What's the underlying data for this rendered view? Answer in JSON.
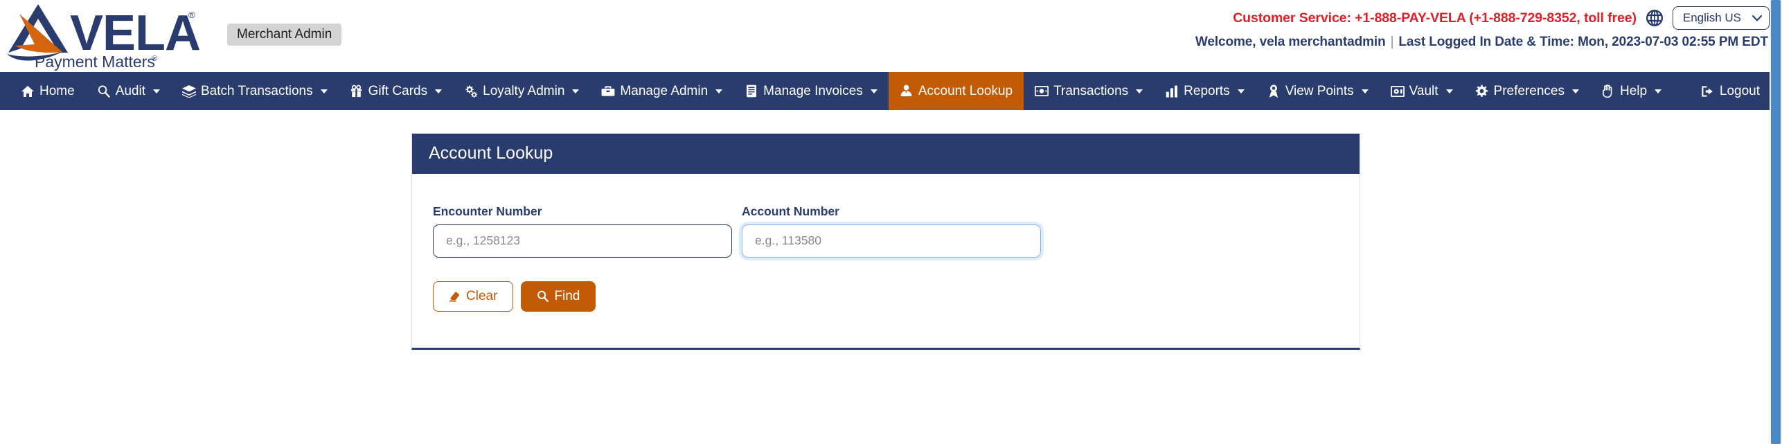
{
  "brand": {
    "name": "VELA",
    "tagline": "Payment Matters",
    "registered_mark": "®",
    "navy": "#2a3c6e",
    "orange": "#c25a06"
  },
  "header": {
    "role_badge": "Merchant Admin",
    "customer_service": "Customer Service: +1-888-PAY-VELA (+1-888-729-8352, toll free)",
    "globe_icon": "globe-icon",
    "language": {
      "selected": "English US",
      "caret_icon": "chevron-down-icon"
    },
    "welcome": "Welcome, vela merchantadmin",
    "separator": "|",
    "last_login": "Last Logged In Date & Time: Mon, 2023-07-03 02:55 PM EDT"
  },
  "nav": {
    "items": [
      {
        "label": "Home",
        "icon": "home-icon",
        "caret": false,
        "active": false
      },
      {
        "label": "Audit",
        "icon": "magnifier-icon",
        "caret": true,
        "active": false
      },
      {
        "label": "Batch Transactions",
        "icon": "layers-icon",
        "caret": true,
        "active": false
      },
      {
        "label": "Gift Cards",
        "icon": "gift-icon",
        "caret": true,
        "active": false
      },
      {
        "label": "Loyalty Admin",
        "icon": "gears-icon",
        "caret": true,
        "active": false
      },
      {
        "label": "Manage Admin",
        "icon": "toolbox-icon",
        "caret": true,
        "active": false
      },
      {
        "label": "Manage Invoices",
        "icon": "invoice-icon",
        "caret": true,
        "active": false
      },
      {
        "label": "Account Lookup",
        "icon": "user-tie-icon",
        "caret": false,
        "active": true
      },
      {
        "label": "Transactions",
        "icon": "money-icon",
        "caret": true,
        "active": false
      },
      {
        "label": "Reports",
        "icon": "bar-chart-icon",
        "caret": true,
        "active": false
      },
      {
        "label": "View Points",
        "icon": "medal-icon",
        "caret": true,
        "active": false
      },
      {
        "label": "Vault",
        "icon": "vault-icon",
        "caret": true,
        "active": false
      },
      {
        "label": "Preferences",
        "icon": "gear-icon",
        "caret": true,
        "active": false
      },
      {
        "label": "Help",
        "icon": "hand-icon",
        "caret": true,
        "active": false
      }
    ],
    "logout": {
      "label": "Logout",
      "icon": "logout-icon"
    }
  },
  "card": {
    "title": "Account Lookup",
    "fields": {
      "encounter": {
        "label": "Encounter Number",
        "placeholder": "e.g., 1258123",
        "value": "",
        "focused": false
      },
      "account": {
        "label": "Account Number",
        "placeholder": "e.g., 113580",
        "value": "",
        "focused": true
      }
    },
    "buttons": {
      "clear": {
        "label": "Clear",
        "icon": "eraser-icon"
      },
      "find": {
        "label": "Find",
        "icon": "search-icon"
      }
    }
  }
}
